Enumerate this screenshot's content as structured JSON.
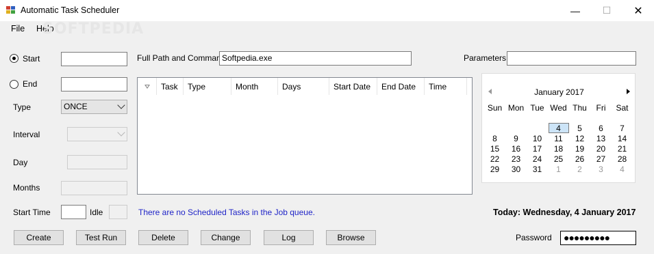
{
  "window": {
    "title": "Automatic Task Scheduler"
  },
  "menu": [
    "File",
    "Help"
  ],
  "watermark": "SOFTPEDIA",
  "left": {
    "start_label": "Start",
    "end_label": "End",
    "start_selected": true,
    "start_value": "",
    "end_value": "",
    "type_label": "Type",
    "type_value": "ONCE",
    "interval_label": "Interval",
    "interval_value": "",
    "day_label": "Day",
    "months_label": "Months",
    "start_time_label": "Start Time",
    "idle_label": "Idle"
  },
  "command": {
    "label": "Full Path and Command",
    "value": "Softpedia.exe",
    "parameters_label": "Parameters",
    "parameters_value": ""
  },
  "listview": {
    "columns": [
      "Task",
      "Type",
      "Month",
      "Days",
      "Start Date",
      "End Date",
      "Time"
    ],
    "rows": []
  },
  "calendar": {
    "title": "January 2017",
    "dow": [
      "Sun",
      "Mon",
      "Tue",
      "Wed",
      "Thu",
      "Fri",
      "Sat"
    ],
    "weeks": [
      [
        "",
        "",
        "",
        "4",
        "5",
        "6",
        "7"
      ],
      [
        "8",
        "9",
        "10",
        "11",
        "12",
        "13",
        "14"
      ],
      [
        "15",
        "16",
        "17",
        "18",
        "19",
        "20",
        "21"
      ],
      [
        "22",
        "23",
        "24",
        "25",
        "26",
        "27",
        "28"
      ],
      [
        "29",
        "30",
        "31",
        "1",
        "2",
        "3",
        "4"
      ]
    ],
    "today": "4"
  },
  "status": "There are no Scheduled Tasks in the Job queue.",
  "today_text": "Today: Wednesday, 4 January 2017",
  "buttons": [
    "Create",
    "Test Run",
    "Delete",
    "Change",
    "Log",
    "Browse"
  ],
  "password": {
    "label": "Password",
    "value": "●●●●●●●●●"
  },
  "colors": {
    "status": "#1f24c7",
    "today_highlight": "#cce4f7"
  }
}
